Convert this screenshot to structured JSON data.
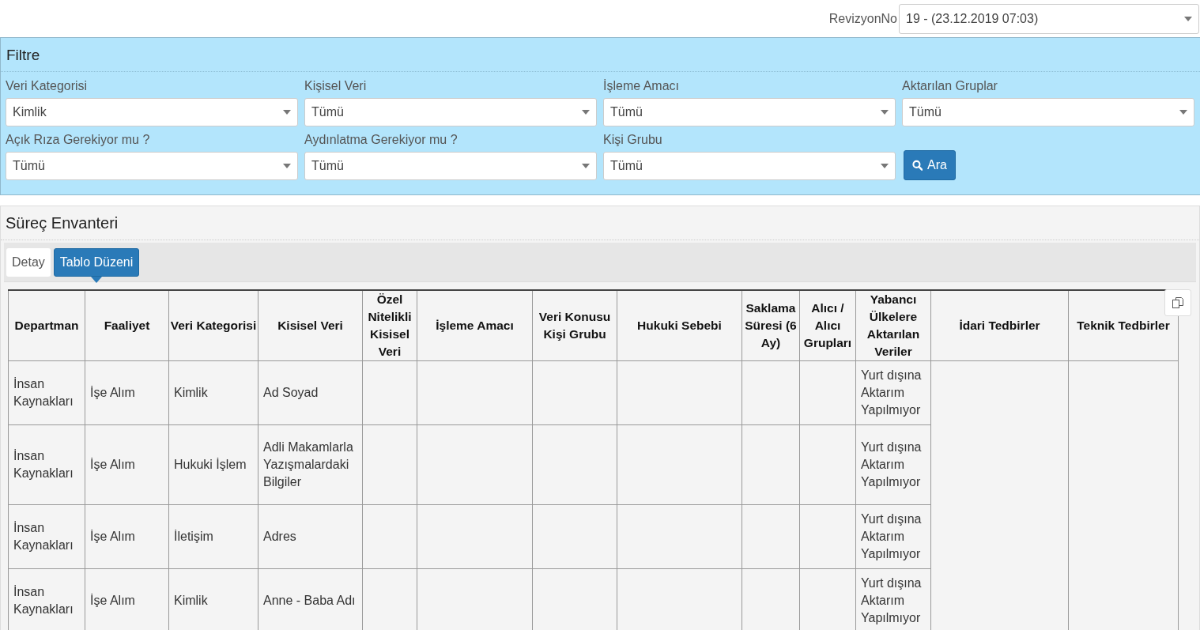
{
  "revision": {
    "label": "RevizyonNo",
    "value": "19 - (23.12.2019 07:03)"
  },
  "filter": {
    "title": "Filtre",
    "fields": [
      {
        "label": "Veri Kategorisi",
        "value": "Kimlik"
      },
      {
        "label": "Kişisel Veri",
        "value": "Tümü"
      },
      {
        "label": "İşleme Amacı",
        "value": "Tümü"
      },
      {
        "label": "Aktarılan Gruplar",
        "value": "Tümü"
      },
      {
        "label": "Açık Rıza Gerekiyor mu ?",
        "value": "Tümü"
      },
      {
        "label": "Aydınlatma Gerekiyor mu ?",
        "value": "Tümü"
      },
      {
        "label": "Kişi Grubu",
        "value": "Tümü"
      }
    ],
    "search_button": "Ara"
  },
  "inventory": {
    "title": "Süreç Envanteri",
    "tabs": [
      {
        "label": "Detay",
        "selected": false
      },
      {
        "label": "Tablo Düzeni",
        "selected": true
      }
    ],
    "table": {
      "columns": [
        "Departman",
        "Faaliyet",
        "Veri Kategorisi",
        "Kisisel Veri",
        "Özel Nitelikli Kisisel Veri",
        "İşleme Amacı",
        "Veri Konusu Kişi Grubu",
        "Hukuki Sebebi",
        "Saklama Süresi (6 Ay)",
        "Alıcı / Alıcı Grupları",
        "Yabancı Ülkelere Aktarılan Veriler",
        "İdari Tedbirler",
        "Teknik Tedbirler"
      ],
      "rows": [
        {
          "cells": [
            "İnsan Kaynakları",
            "İşe Alım",
            "Kimlik",
            "Ad Soyad"
          ],
          "transfer": "Yurt dışına Aktarım Yapılmıyor"
        },
        {
          "cells": [
            "İnsan Kaynakları",
            "İşe Alım",
            "Hukuki İşlem",
            "Adli Makamlarla Yazışmalardaki Bilgiler"
          ],
          "transfer": "Yurt dışına Aktarım Yapılmıyor"
        },
        {
          "cells": [
            "İnsan Kaynakları",
            "İşe Alım",
            "İletişim",
            "Adres"
          ],
          "transfer": "Yurt dışına Aktarım Yapılmıyor"
        },
        {
          "cells": [
            "İnsan Kaynakları",
            "İşe Alım",
            "Kimlik",
            "Anne - Baba Adı"
          ],
          "transfer": "Yurt dışına Aktarım Yapılmıyor"
        }
      ]
    }
  }
}
